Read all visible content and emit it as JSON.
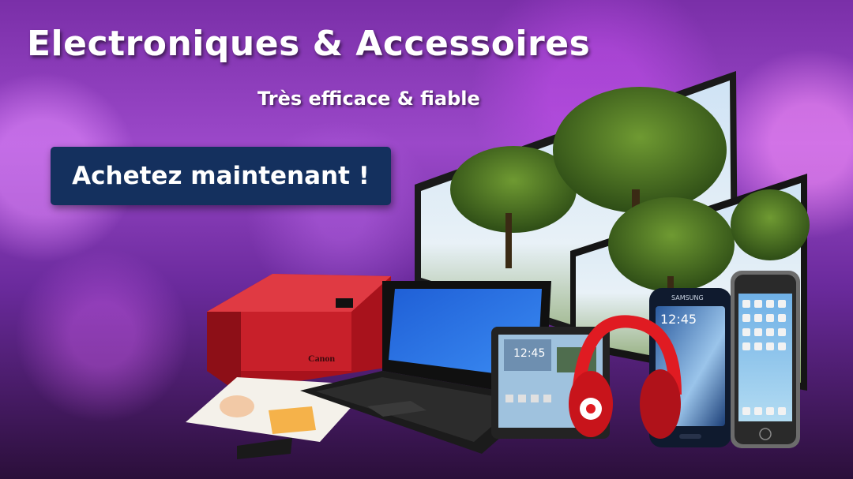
{
  "banner": {
    "headline": "Electroniques & Accessoires",
    "tagline": "Très efficace & fiable",
    "cta_label": "Achetez maintenant !"
  },
  "products": {
    "printer_brand": "Canon",
    "phone_brand": "SAMSUNG",
    "phone_time": "12:45",
    "tablet_time": "12:45"
  },
  "colors": {
    "cta_background": "#14305e",
    "printer": "#c8202a",
    "headphones": "#e01b22"
  }
}
